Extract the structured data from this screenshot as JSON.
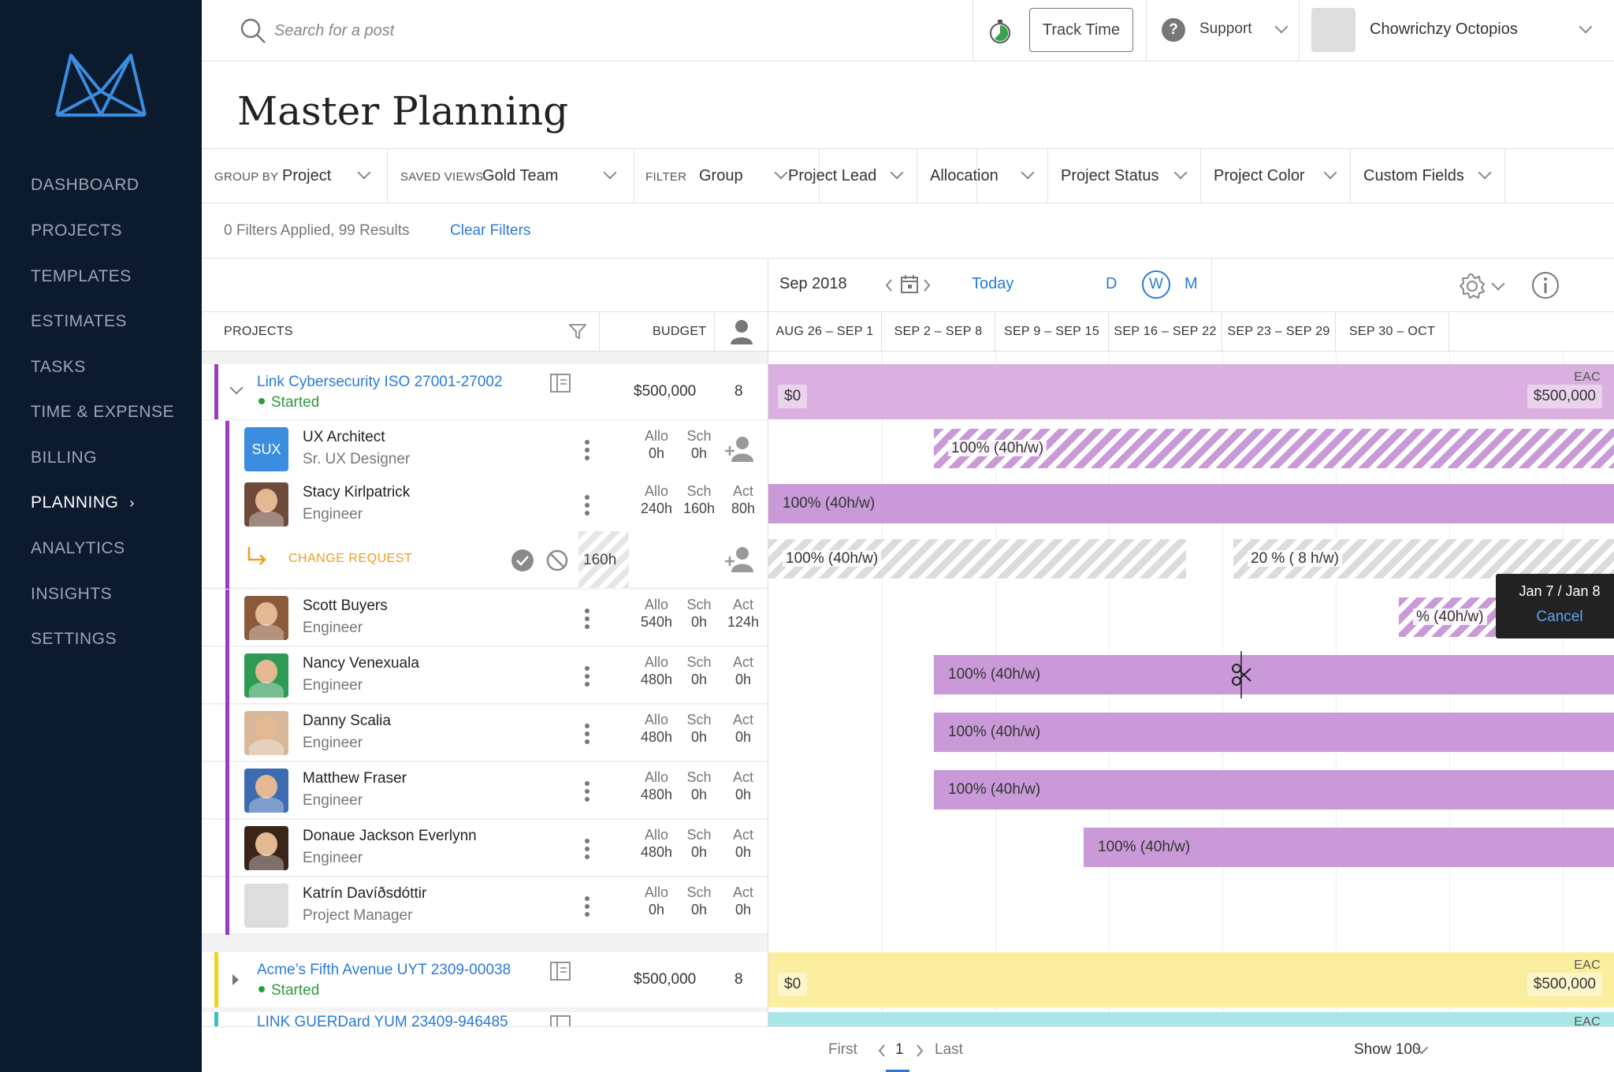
{
  "sidebar": {
    "items": [
      {
        "label": "DASHBOARD"
      },
      {
        "label": "PROJECTS"
      },
      {
        "label": "TEMPLATES"
      },
      {
        "label": "ESTIMATES"
      },
      {
        "label": "TASKS"
      },
      {
        "label": "TIME & EXPENSE"
      },
      {
        "label": "BILLING"
      },
      {
        "label": "PLANNING"
      },
      {
        "label": "ANALYTICS"
      },
      {
        "label": "INSIGHTS"
      },
      {
        "label": "SETTINGS"
      }
    ],
    "active_item": "PLANNING",
    "active_arrow": "›"
  },
  "topbar": {
    "search_placeholder": "Search for a post",
    "track_time_label": "Track Time",
    "support_label": "Support",
    "support_icon_glyph": "?",
    "user_name": "Chowrichzy Octopios"
  },
  "page": {
    "title": "Master Planning"
  },
  "filters": {
    "group_by_label": "GROUP BY",
    "group_by_value": "Project",
    "saved_views_label": "SAVED VIEWS",
    "saved_views_value": "Gold Team",
    "filter_label": "FILTER",
    "group": "Group",
    "project_lead": "Project Lead",
    "allocation": "Allocation",
    "project_status": "Project Status",
    "project_color": "Project Color",
    "custom_fields": "Custom Fields",
    "summary": "0 Filters Applied,  99 Results",
    "clear_label": "Clear Filters"
  },
  "timeline": {
    "month": "Sep 2018",
    "today_label": "Today",
    "views": {
      "d": "D",
      "w": "W",
      "m": "M"
    },
    "active_view": "W",
    "weeks": [
      "AUG 26 – SEP 1",
      "SEP 2 – SEP 8",
      "SEP 9 – SEP 15",
      "SEP 16 – SEP 22",
      "SEP 23 – SEP 29",
      "SEP 30 – OCT"
    ]
  },
  "columns": {
    "projects": "PROJECTS",
    "budget": "BUDGET"
  },
  "metric_labels": {
    "allo": "Allo",
    "sch": "Sch",
    "act": "Act"
  },
  "projects": [
    {
      "name": "Link Cybersecurity ISO 27001-27002",
      "status": "Started",
      "budget": "$500,000",
      "count": "8",
      "color": "#9b3cbf",
      "bar_color": "#dab0e0",
      "spent": "$0",
      "eac_label": "EAC",
      "eac": "$500,000"
    },
    {
      "name": "Acme’s Fifth Avenue UYT 2309-00038",
      "status": "Started",
      "budget": "$500,000",
      "count": "8",
      "color": "#f2d21e",
      "bar_color": "#fbef9f",
      "spent": "$0",
      "eac_label": "EAC",
      "eac": "$500,000"
    },
    {
      "name": "LINK GUERDard YUM 23409-946485",
      "color": "#35c1c1",
      "bar_color": "#a9e6e6",
      "eac_label": "EAC"
    }
  ],
  "people": [
    {
      "initials": "SUX",
      "name": "UX Architect",
      "role": "Sr. UX Designer",
      "allo": "0h",
      "sch": "0h",
      "act": "",
      "bar": "100% (40h/w)",
      "avatar_color": "#3b8de0"
    },
    {
      "name": "Stacy Kirlpatrick",
      "role": "Engineer",
      "allo": "240h",
      "sch": "160h",
      "act": "80h",
      "bar": "100% (40h/w)",
      "avatar_color": "#6d4a3a"
    },
    {
      "name": "Scott Buyers",
      "role": "Engineer",
      "allo": "540h",
      "sch": "0h",
      "act": "124h",
      "bar": "100% (40h/w)",
      "avatar_color": "#8a5a3a"
    },
    {
      "name": "Nancy Venexuala",
      "role": "Engineer",
      "allo": "480h",
      "sch": "0h",
      "act": "0h",
      "bar": "100% (40h/w)",
      "avatar_color": "#2f9a54"
    },
    {
      "name": "Danny Scalia",
      "role": "Engineer",
      "allo": "480h",
      "sch": "0h",
      "act": "0h",
      "bar": "100% (40h/w)",
      "avatar_color": "#d9b89a"
    },
    {
      "name": "Matthew Fraser",
      "role": "Engineer",
      "allo": "480h",
      "sch": "0h",
      "act": "0h",
      "bar": "100% (40h/w)",
      "avatar_color": "#3d6bb0"
    },
    {
      "name": "Donaue Jackson Everlynn",
      "role": "Engineer",
      "allo": "480h",
      "sch": "0h",
      "act": "0h",
      "bar": "100% (40h/w)",
      "avatar_color": "#3a2418"
    },
    {
      "name": "Katrín Davíðsdóttir",
      "role": "Project Manager",
      "allo": "0h",
      "sch": "0h",
      "act": "0h",
      "bar": "",
      "avatar_color": "#dddddd"
    }
  ],
  "change_request": {
    "label": "CHANGE REQUEST",
    "hours": "160h",
    "bar1": "100% (40h/w)",
    "bar2": "20 % ( 8 h/w)",
    "accent": "#f29b1e"
  },
  "partial_bar_label": "% (40h/w)",
  "tooltip": {
    "dates": "Jan 7 / Jan 8",
    "cancel": "Cancel"
  },
  "pagination": {
    "first": "First",
    "page": "1",
    "last": "Last",
    "show": "Show 100"
  }
}
